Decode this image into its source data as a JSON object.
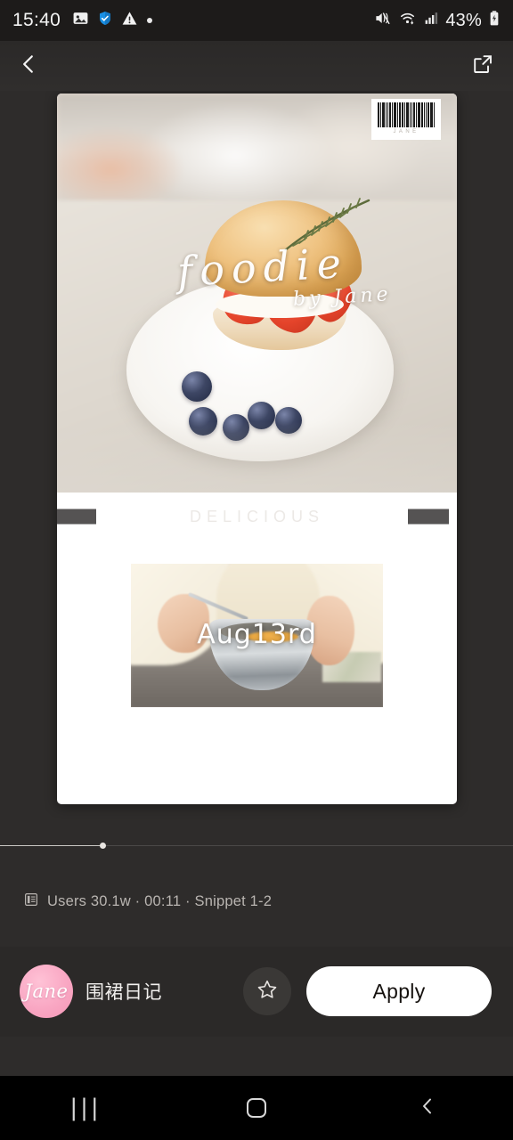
{
  "status_bar": {
    "clock": "15:40",
    "battery_percent": "43%",
    "left_icons": [
      "gallery-icon",
      "shield-check-icon",
      "warning-triangle-icon",
      "dot-icon"
    ],
    "right_icons": [
      "volume-muted-icon",
      "wifi-icon",
      "cellular-signal-icon",
      "battery-charging-icon"
    ]
  },
  "top_nav": {
    "back_icon": "chevron-left-icon",
    "share_icon": "external-link-icon"
  },
  "card": {
    "hero": {
      "title": "foodie",
      "subtitle": "by Jane",
      "barcode_label": "JANE"
    },
    "caption": {
      "text": "DELICIOUS",
      "redacted": true
    },
    "media_tile": {
      "date_overlay": "Aug13rd"
    }
  },
  "scrubber": {
    "progress_percent": 20
  },
  "meta": {
    "icon": "document-list-icon",
    "text": "Users 30.1w · 00:11 · Snippet 1-2"
  },
  "action_bar": {
    "avatar_text": "Jane",
    "author_name": "围裙日记",
    "favorite_icon": "star-outline-icon",
    "apply_label": "Apply"
  },
  "nav_bar": {
    "recents_glyph": "|||",
    "recents_icon": "recents-icon",
    "home_icon": "home-icon",
    "back_icon": "back-icon"
  },
  "colors": {
    "background": "#2e2c2b",
    "card": "#ffffff",
    "accent_avatar": "#f596b6",
    "apply_bg": "#ffffff",
    "apply_text": "#16120f",
    "meta_text": "#b9b5b1"
  }
}
